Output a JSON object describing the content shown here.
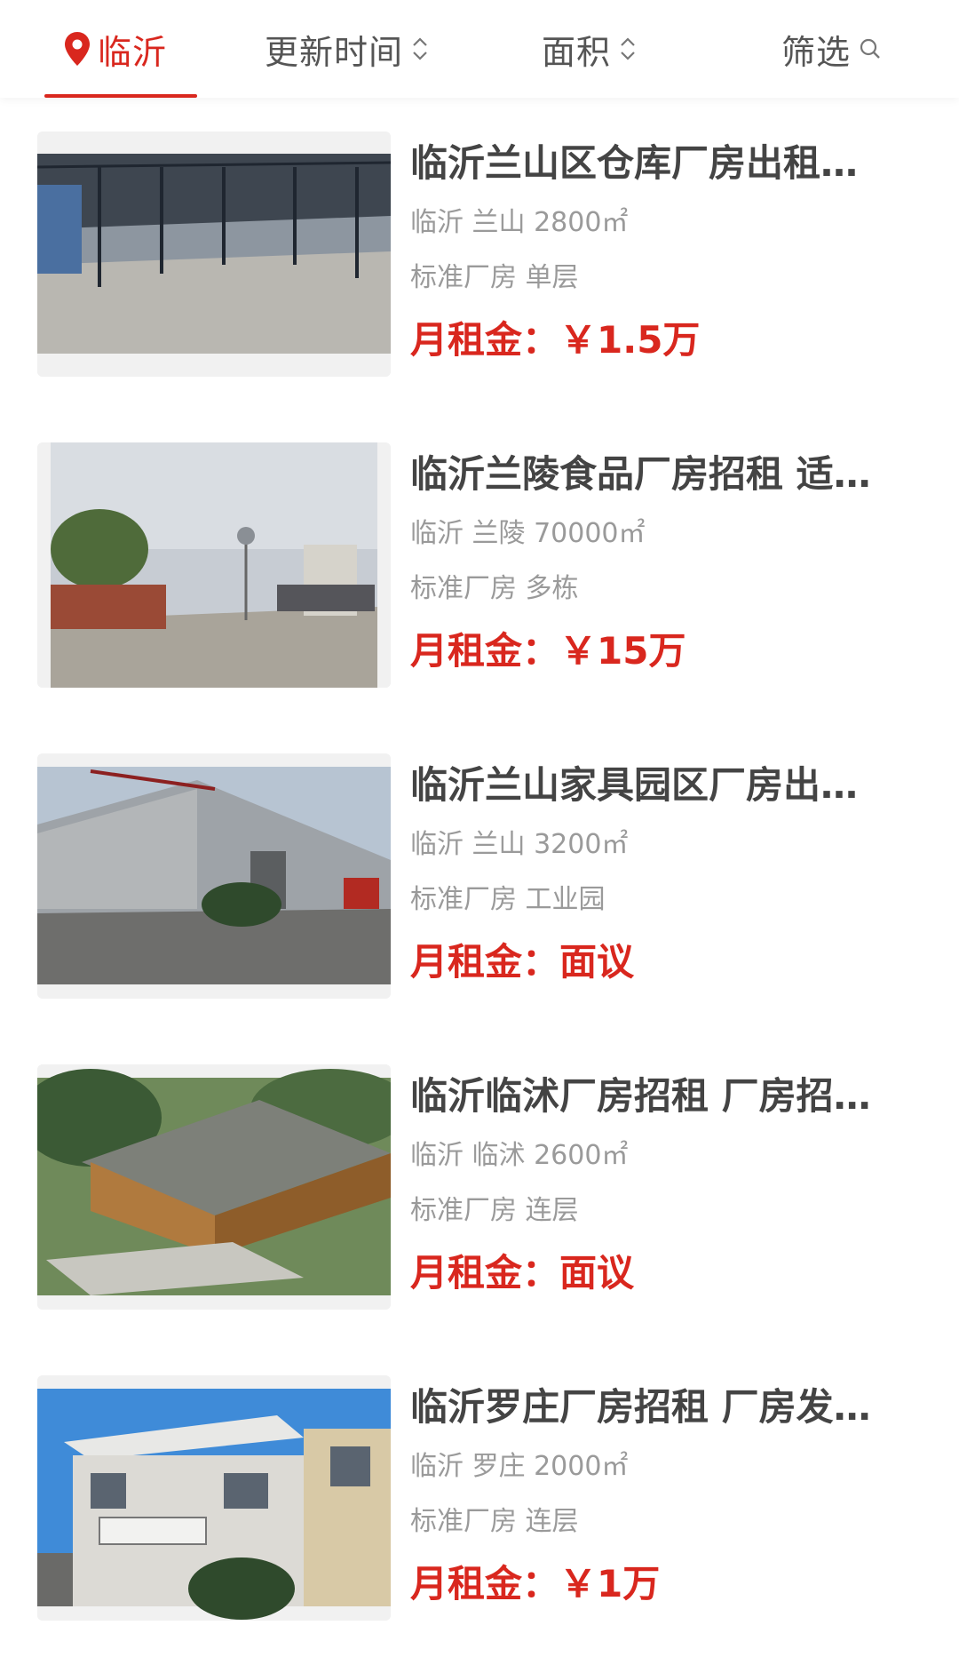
{
  "filter_bar": {
    "city": "临沂",
    "sort_time": "更新时间",
    "sort_area": "面积",
    "filter": "筛选"
  },
  "accent_color": "#d9271e",
  "listings": [
    {
      "title": "临沂兰山区仓库厂房出租…",
      "location": "临沂 兰山 2800㎡",
      "tags": "标准厂房 单层",
      "price_label": "月租金：",
      "price": "￥1.5万",
      "image": "warehouse-interior-photo"
    },
    {
      "title": "临沂兰陵食品厂房招租 适…",
      "location": "临沂 兰陵 70000㎡",
      "tags": "标准厂房 多栋",
      "price_label": "月租金：",
      "price": "￥15万",
      "image": "factory-gate-photo"
    },
    {
      "title": "临沂兰山家具园区厂房出…",
      "location": "临沂 兰山 3200㎡",
      "tags": "标准厂房 工业园",
      "price_label": "月租金：",
      "price": "面议",
      "image": "industrial-park-building-photo"
    },
    {
      "title": "临沂临沭厂房招租 厂房招…",
      "location": "临沂 临沭 2600㎡",
      "tags": "标准厂房 连层",
      "price_label": "月租金：",
      "price": "面议",
      "image": "factory-rendering-photo"
    },
    {
      "title": "临沂罗庄厂房招租 厂房发…",
      "location": "临沂 罗庄 2000㎡",
      "tags": "标准厂房 连层",
      "price_label": "月租金：",
      "price": "￥1万",
      "image": "office-building-photo"
    }
  ]
}
